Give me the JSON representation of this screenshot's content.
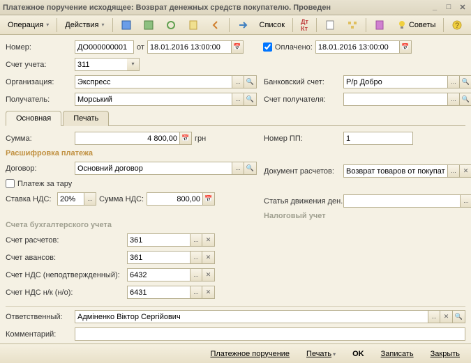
{
  "title": "Платежное поручение исходящее: Возврат денежных средств покупателю. Проведен",
  "toolbar": {
    "operation": "Операция",
    "actions": "Действия",
    "list": "Список",
    "tips": "Советы"
  },
  "form": {
    "number_lbl": "Номер:",
    "number": "ДО000000001",
    "from": "от",
    "date": "18.01.2016 13:00:00",
    "paid_lbl": "Оплачено:",
    "paid_date": "18.01.2016 13:00:00",
    "account_lbl": "Счет учета:",
    "account": "311",
    "org_lbl": "Организация:",
    "org": "Экспресс",
    "bank_lbl": "Банковский счет:",
    "bank": "Р/р Добро",
    "recipient_lbl": "Получатель:",
    "recipient": "Морський",
    "recip_acc_lbl": "Счет получателя:"
  },
  "tabs": {
    "main": "Основная",
    "print": "Печать"
  },
  "main": {
    "sum_lbl": "Сумма:",
    "sum": "4 800,00",
    "currency": "грн",
    "pp_lbl": "Номер ПП:",
    "pp": "1",
    "decode_title": "Расшифровка платежа",
    "contract_lbl": "Договор:",
    "contract": "Основний договор",
    "doc_lbl": "Документ расчетов:",
    "doc": "Возврат товаров от покупателя",
    "tare_lbl": "Платеж за тару",
    "vat_rate_lbl": "Ставка НДС:",
    "vat_rate": "20%",
    "vat_sum_lbl": "Сумма НДС:",
    "vat_sum": "800,00",
    "art_lbl": "Статья движения ден. средств:",
    "tax_title": "Налоговый учет",
    "acc_title": "Счета бухгалтерского учета",
    "acc1_lbl": "Счет расчетов:",
    "acc1": "361",
    "acc2_lbl": "Счет авансов:",
    "acc2": "361",
    "acc3_lbl": "Счет НДС (неподтвержденный):",
    "acc3": "6432",
    "acc4_lbl": "Счет НДС н/к (н/о):",
    "acc4": "6431"
  },
  "footer": {
    "resp_lbl": "Ответственный:",
    "resp": "Адміненко Віктор Сергійович",
    "comment_lbl": "Комментарий:"
  },
  "bottom": {
    "payment": "Платежное поручение",
    "print": "Печать",
    "ok": "OK",
    "save": "Записать",
    "close": "Закрыть"
  }
}
